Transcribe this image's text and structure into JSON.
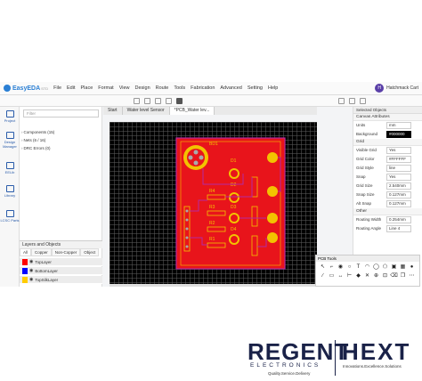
{
  "app": {
    "logo_text": "EasyEDA",
    "logo_version": "STD",
    "menu": [
      "File",
      "Edit",
      "Place",
      "Format",
      "View",
      "Design",
      "Route",
      "Tools",
      "Fabrication",
      "Advanced",
      "Setting",
      "Help"
    ],
    "user_initial": "H",
    "user_name": "Hatchmack Cart"
  },
  "left_rail": [
    {
      "label": "Project"
    },
    {
      "label": "Design Manager"
    },
    {
      "label": "EELib"
    },
    {
      "label": "Library"
    },
    {
      "label": "LCSC Parts"
    }
  ],
  "panel": {
    "filter_placeholder": "Filter",
    "tree": [
      {
        "label": "Components (15)"
      },
      {
        "label": "Nets (6 / 16)"
      },
      {
        "label": "DRC Errors (0)"
      }
    ]
  },
  "layers": {
    "title": "Layers and Objects",
    "tabs": [
      "All",
      "Copper",
      "Non-Copper",
      "Object"
    ],
    "rows": [
      {
        "name": "TopLayer",
        "color": "#ff0000"
      },
      {
        "name": "BottomLayer",
        "color": "#0000ff"
      },
      {
        "name": "TopSilkLayer",
        "color": "#ffcc00"
      }
    ]
  },
  "tabs": [
    {
      "label": "Start"
    },
    {
      "label": "Water level Sensor"
    },
    {
      "label": "*PCB_Water lev..."
    }
  ],
  "board": {
    "silk_labels": [
      "BD1",
      "D1",
      "D2",
      "R4",
      "R3",
      "R2",
      "R1",
      "D3",
      "D4"
    ]
  },
  "right_panel": {
    "title": "Selected Objects",
    "sections": {
      "canvas_attributes": "Canvas Attributes",
      "grid": "Grid",
      "other": "Other"
    },
    "units_label": "Units",
    "units_value": "mm",
    "background_label": "Background",
    "background_value": "#000000",
    "visible_grid_label": "Visible Grid",
    "visible_grid_value": "Yes",
    "grid_color_label": "Grid Color",
    "grid_color_value": "#FFFFFF",
    "grid_style_label": "Grid Style",
    "grid_style_value": "line",
    "snap_label": "Snap",
    "snap_value": "Yes",
    "grid_size_label": "Grid Size",
    "grid_size_value": "2.540mm",
    "snap_size_label": "Snap Size",
    "snap_size_value": "0.127mm",
    "alt_snap_label": "Alt Snap",
    "alt_snap_value": "0.127mm",
    "routing_width_label": "Routing Width",
    "routing_width_value": "0.254mm",
    "routing_angle_label": "Routing Angle",
    "routing_angle_value": "Line 4"
  },
  "pcb_tools": {
    "title": "PCB Tools",
    "icons": [
      "pointer-icon",
      "track-icon",
      "pad-icon",
      "via-icon",
      "text-icon",
      "arc-icon",
      "circle-icon",
      "polygon-icon",
      "image-icon",
      "copper-area-icon",
      "hole-icon"
    ]
  },
  "branding": {
    "regent": "REGENT",
    "electronics": "ELECTRONICS",
    "regent_tagline": "Quality.Service.Delivery",
    "hext": "HEXT",
    "hext_tagline": "Innovations.Excellence.Solutions"
  }
}
